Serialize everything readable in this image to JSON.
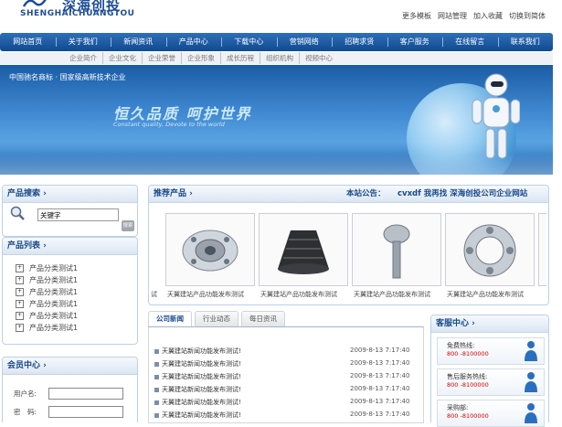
{
  "header": {
    "logo_cn": "深海创投",
    "logo_en": "SHENGHAICHUANGTOU",
    "top_links": [
      "更多模板",
      "网站管理",
      "加入收藏",
      "切换到简体"
    ]
  },
  "nav": [
    "网站首页",
    "关于我们",
    "新闻资讯",
    "产品中心",
    "下载中心",
    "营销网络",
    "招聘求贤",
    "客户服务",
    "在线留言",
    "联系我们"
  ],
  "subnav": [
    "企业简介",
    "企业文化",
    "企业荣誉",
    "企业形象",
    "成长历程",
    "组织机构",
    "视频中心"
  ],
  "banner": {
    "tag": "中国驰名商标 · 国家级高新技术企业",
    "title": "恒久品质 呵护世界",
    "subtitle": "Constant quality, Devote to the world"
  },
  "search": {
    "title": "产品搜索",
    "placeholder": "关键字",
    "button": "搜索"
  },
  "categories": {
    "title": "产品列表",
    "items": [
      "产品分类测试1",
      "产品分类测试1",
      "产品分类测试1",
      "产品分类测试1",
      "产品分类测试1",
      "产品分类测试1"
    ]
  },
  "member": {
    "title": "会员中心",
    "username_label": "用户名:",
    "password_label": "密　码:"
  },
  "recommend": {
    "title": "推荐产品",
    "notice_label": "本站公告：",
    "notice_text": "cvxdf  我再找  深海创投公司企业网站",
    "left_edge_caption": "试",
    "products": [
      {
        "caption": "天翼建站产品功能发布测试"
      },
      {
        "caption": "天翼建站产品功能发布测试"
      },
      {
        "caption": "天翼建站产品功能发布测试"
      },
      {
        "caption": "天翼建站产品功能发布测试"
      }
    ]
  },
  "news": {
    "tabs": [
      "公司新闻",
      "行业动态",
      "每日资讯"
    ],
    "active_tab": 0,
    "items": [
      {
        "title": "天翼建站新闻功能发布测试!",
        "date": "2009-8-13 7:17:40"
      },
      {
        "title": "天翼建站新闻功能发布测试!",
        "date": "2009-8-13 7:17:40"
      },
      {
        "title": "天翼建站新闻功能发布测试!",
        "date": "2009-8-13 7:17:40"
      },
      {
        "title": "天翼建站新闻功能发布测试!",
        "date": "2009-8-13 7:17:40"
      },
      {
        "title": "天翼建站新闻功能发布测试!",
        "date": "2009-8-13 7:17:40"
      },
      {
        "title": "天翼建站新闻功能发布测试!",
        "date": "2009-8-13 7:17:40"
      }
    ]
  },
  "service": {
    "title": "客服中心",
    "items": [
      {
        "label": "免费热线:",
        "phone": "800 -8100000"
      },
      {
        "label": "售后服务热线:",
        "phone": "800 -8100000"
      },
      {
        "label": "采购部:",
        "phone": "800 -8100000"
      }
    ]
  },
  "colors": {
    "nav_blue": "#1a5aa3",
    "heading_blue": "#17498a",
    "phone_red": "#d10000"
  }
}
